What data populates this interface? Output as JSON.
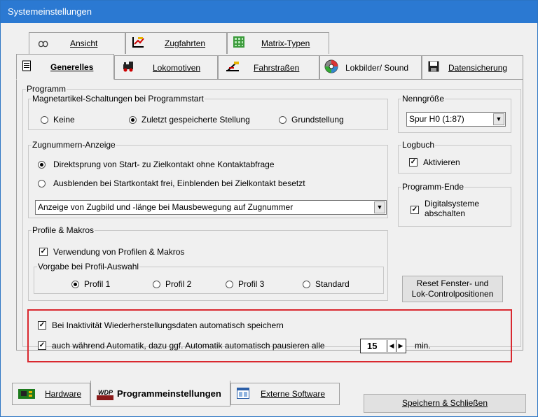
{
  "window": {
    "title": "Systemeinstellungen"
  },
  "tabs_row1": [
    {
      "label": "Ansicht",
      "icon": "glasses-icon"
    },
    {
      "label": "Zugfahrten",
      "icon": "chart-icon"
    },
    {
      "label": "Matrix-Typen",
      "icon": "grid-icon"
    }
  ],
  "tabs_row2": [
    {
      "label": "Generelles",
      "icon": "document-icon",
      "selected": true
    },
    {
      "label": "Lokomotiven",
      "icon": "locomotive-icon"
    },
    {
      "label": "Fahrstraßen",
      "icon": "route-icon"
    },
    {
      "label": "Lokbilder/ Sound",
      "icon": "speaker-icon"
    },
    {
      "label": "Datensicherung",
      "icon": "floppy-icon"
    }
  ],
  "programm": {
    "legend": "Programm",
    "magnet": {
      "legend": "Magnetartikel-Schaltungen bei Programmstart",
      "options": [
        "Keine",
        "Zuletzt gespeicherte Stellung",
        "Grundstellung"
      ],
      "selected": 1
    },
    "zugnummern": {
      "legend": "Zugnummern-Anzeige",
      "options": [
        "Direktsprung von Start- zu  Zielkontakt ohne Kontaktabfrage",
        "Ausblenden bei Startkontakt frei, Einblenden bei Zielkontakt besetzt"
      ],
      "selected": 0,
      "combo_value": "Anzeige von Zugbild und -länge bei Mausbewegung auf Zugnummer"
    },
    "profile": {
      "legend": "Profile & Makros",
      "use_label": "Verwendung von Profilen  & Makros",
      "use_checked": true,
      "vorgabe": {
        "legend": "Vorgabe bei Profil-Auswahl",
        "options": [
          "Profil 1",
          "Profil 2",
          "Profil 3",
          "Standard"
        ],
        "selected": 0
      }
    },
    "nenngroesse": {
      "legend": "Nenngröße",
      "value": "Spur H0 (1:87)"
    },
    "logbuch": {
      "legend": "Logbuch",
      "label": "Aktivieren",
      "checked": true
    },
    "programm_ende": {
      "legend": "Programm-Ende",
      "label_line1": "Digitalsysteme",
      "label_line2": "abschalten",
      "checked": true
    },
    "reset_button": {
      "line1": "Reset Fenster- und",
      "line2": "Lok-Controlpositionen"
    },
    "autosave": {
      "label1": "Bei Inaktivität Wiederherstellungsdaten automatisch speichern",
      "checked1": true,
      "label2": "auch während Automatik, dazu ggf. Automatik automatisch pausieren alle",
      "checked2": true,
      "minutes": "15",
      "unit": "min."
    }
  },
  "bottom_tabs": [
    {
      "label": "Hardware",
      "icon": "circuit-board-icon"
    },
    {
      "label": "Programmeinstellungen",
      "icon": "wdp-logo-icon",
      "selected": true
    },
    {
      "label": "Externe Software",
      "icon": "window-icon"
    }
  ],
  "save_button": {
    "label": "Speichern & Schließen"
  },
  "colors": {
    "titlebar": "#2b79d2",
    "highlight_border": "#d9282f"
  }
}
